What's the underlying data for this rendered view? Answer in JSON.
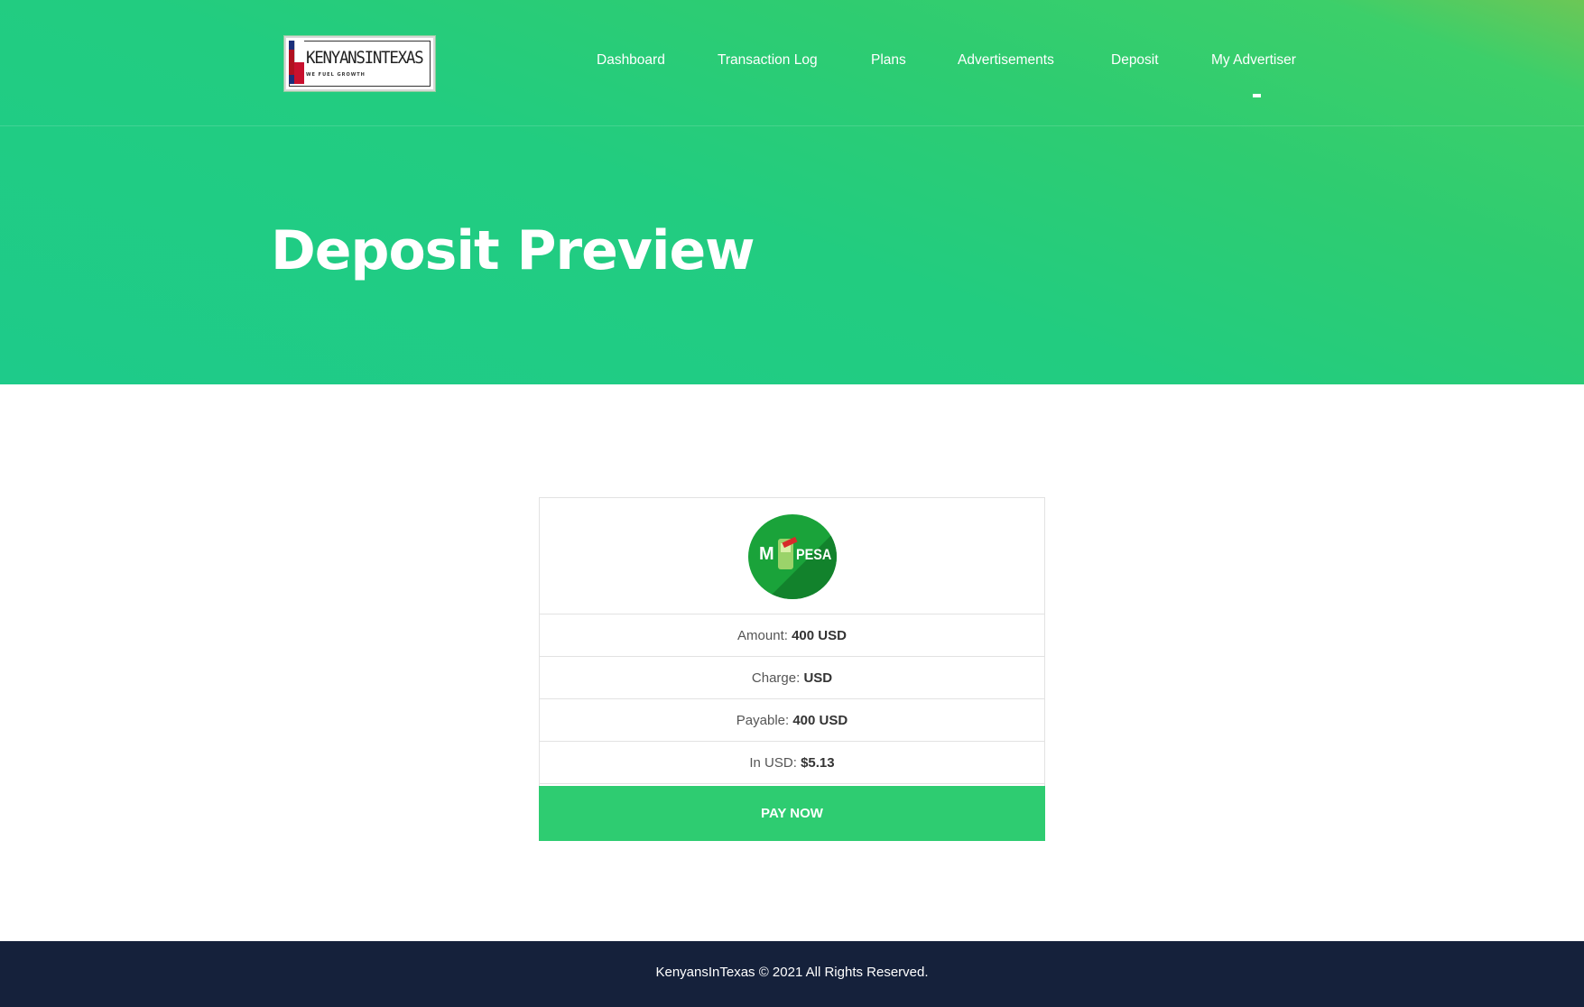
{
  "header": {
    "logo": {
      "brand_text": "KENYANSINTEXAS",
      "tagline": "WE FUEL GROWTH"
    },
    "nav": [
      {
        "label": "Dashboard"
      },
      {
        "label": "Transaction Log"
      },
      {
        "label": "Plans"
      },
      {
        "label": "Advertisements"
      },
      {
        "label": "Deposit"
      },
      {
        "label": "My Advertiser"
      }
    ]
  },
  "hero": {
    "title": "Deposit Preview"
  },
  "card": {
    "gateway_icon": "mpesa-logo-icon",
    "gateway_logo_text": {
      "m": "M",
      "pesa": "PESA"
    },
    "rows": [
      {
        "label": "Amount:",
        "value": "400 USD"
      },
      {
        "label": "Charge:",
        "value": "USD"
      },
      {
        "label": "Payable:",
        "value": "400 USD"
      },
      {
        "label": "In USD:",
        "value": "$5.13"
      }
    ],
    "pay_button": "PAY NOW"
  },
  "footer": {
    "copyright": "KenyansInTexas © 2021 All Rights Reserved."
  },
  "colors": {
    "accent_green": "#2ecc71",
    "hero_gradient_start": "#6cc756",
    "hero_gradient_end": "#1ecb8a",
    "footer_bg": "#15213b",
    "mpesa_green": "#1aa33a"
  }
}
